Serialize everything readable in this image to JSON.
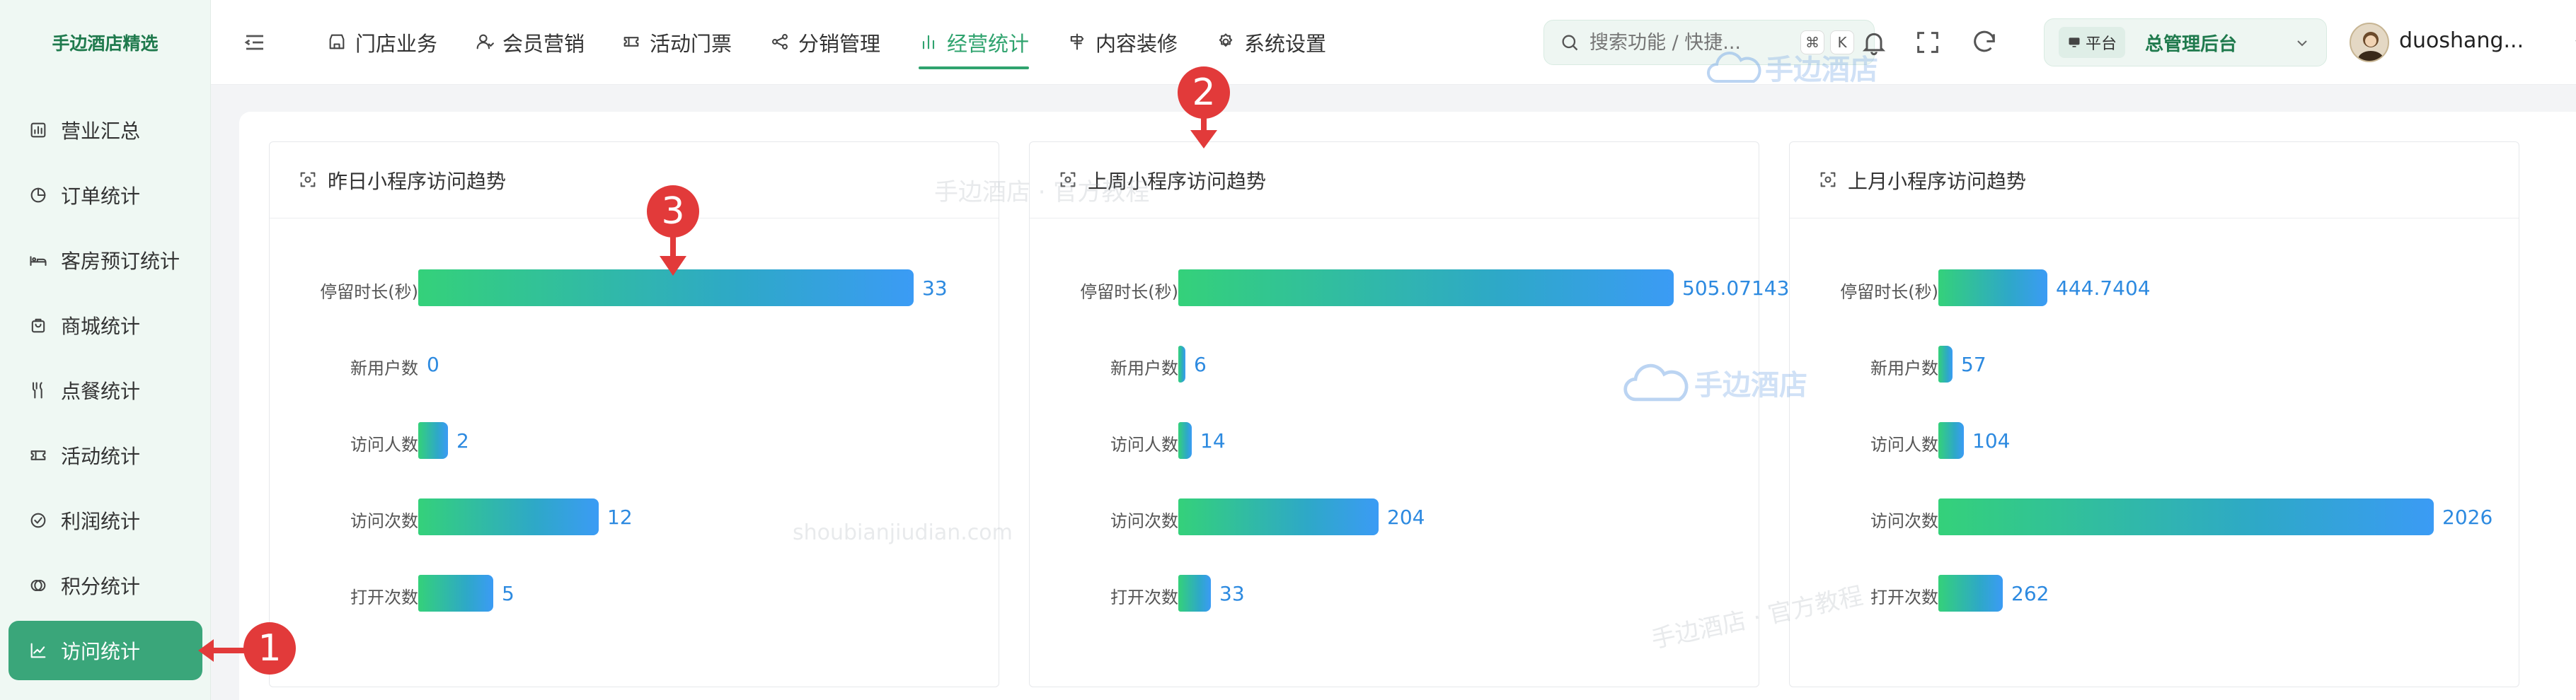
{
  "sidebar": {
    "logo": "手边酒店精选",
    "items": [
      {
        "label": "营业汇总",
        "icon": "report-icon"
      },
      {
        "label": "订单统计",
        "icon": "pie-icon"
      },
      {
        "label": "客房预订统计",
        "icon": "bed-icon"
      },
      {
        "label": "商城统计",
        "icon": "bag-icon"
      },
      {
        "label": "点餐统计",
        "icon": "fork-knife-icon"
      },
      {
        "label": "活动统计",
        "icon": "ticket-icon"
      },
      {
        "label": "利润统计",
        "icon": "check-circle-icon"
      },
      {
        "label": "积分统计",
        "icon": "coins-icon"
      },
      {
        "label": "访问统计",
        "icon": "line-chart-icon",
        "active": true
      }
    ]
  },
  "header": {
    "tabs": [
      {
        "label": "门店业务",
        "icon": "store-icon"
      },
      {
        "label": "会员营销",
        "icon": "user-icon"
      },
      {
        "label": "活动门票",
        "icon": "ticket-icon"
      },
      {
        "label": "分销管理",
        "icon": "share-icon"
      },
      {
        "label": "经营统计",
        "icon": "bar-chart-icon",
        "active": true
      },
      {
        "label": "内容装修",
        "icon": "signpost-icon"
      },
      {
        "label": "系统设置",
        "icon": "gear-icon"
      }
    ],
    "search_placeholder": "搜索功能 / 快捷...",
    "kbd1": "⌘",
    "kbd2": "K",
    "platform_badge": "平台",
    "platform_name": "总管理后台",
    "username": "duoshang..."
  },
  "cards": [
    {
      "title": "昨日小程序访问趋势",
      "max": 33,
      "rows": [
        {
          "label": "停留时长(秒)",
          "value": 33,
          "display": "33"
        },
        {
          "label": "新用户数",
          "value": 0,
          "display": "0"
        },
        {
          "label": "访问人数",
          "value": 2,
          "display": "2"
        },
        {
          "label": "访问次数",
          "value": 12,
          "display": "12"
        },
        {
          "label": "打开次数",
          "value": 5,
          "display": "5"
        }
      ]
    },
    {
      "title": "上周小程序访问趋势",
      "max": 505.07143,
      "rows": [
        {
          "label": "停留时长(秒)",
          "value": 505.07143,
          "display": "505.07143"
        },
        {
          "label": "新用户数",
          "value": 6,
          "display": "6"
        },
        {
          "label": "访问人数",
          "value": 14,
          "display": "14"
        },
        {
          "label": "访问次数",
          "value": 204,
          "display": "204"
        },
        {
          "label": "打开次数",
          "value": 33,
          "display": "33"
        }
      ]
    },
    {
      "title": "上月小程序访问趋势",
      "max": 2026,
      "rows": [
        {
          "label": "停留时长(秒)",
          "value": 444.7404,
          "display": "444.7404"
        },
        {
          "label": "新用户数",
          "value": 57,
          "display": "57"
        },
        {
          "label": "访问人数",
          "value": 104,
          "display": "104"
        },
        {
          "label": "访问次数",
          "value": 2026,
          "display": "2026"
        },
        {
          "label": "打开次数",
          "value": 262,
          "display": "262"
        }
      ]
    }
  ],
  "watermarks": {
    "brand": "手边酒店",
    "tutorial": "手边酒店 · 官方教程",
    "domain": "shoubianjiudian.com"
  },
  "markers": [
    "1",
    "2",
    "3"
  ]
}
